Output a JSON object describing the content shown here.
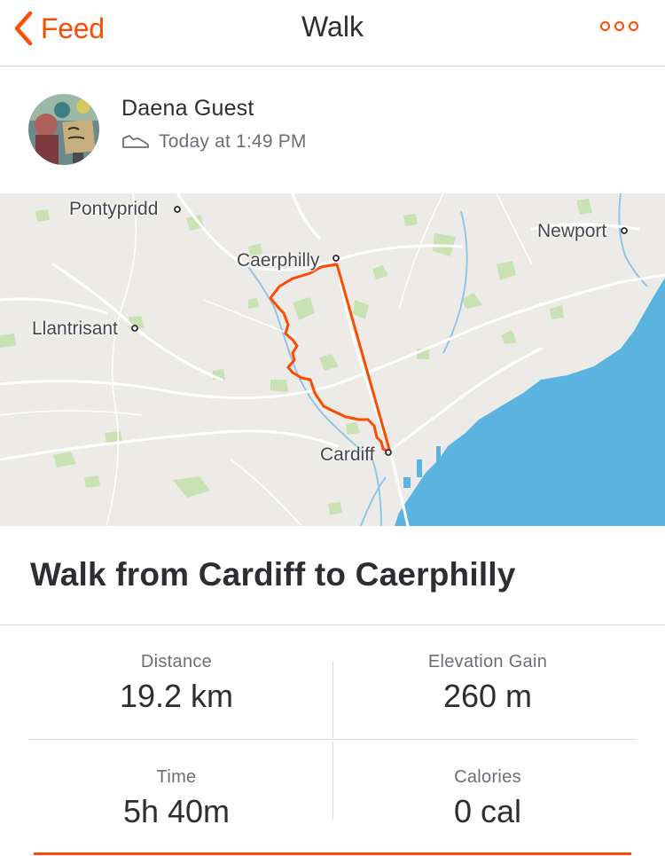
{
  "navbar": {
    "back_label": "Feed",
    "back_icon": "chevron-left-icon",
    "title": "Walk",
    "more_icon": "more-options-icon",
    "accent_color": "#fc4c02"
  },
  "athlete": {
    "name": "Daena Guest",
    "activity_icon": "shoe-icon",
    "timestamp": "Today at 1:49 PM"
  },
  "map": {
    "places": {
      "pontypridd": "Pontypridd",
      "newport": "Newport",
      "caerphilly": "Caerphilly",
      "llantrisant": "Llantrisant",
      "cardiff": "Cardiff"
    },
    "route_color": "#fc4c02",
    "sea_color": "#5bb3e0"
  },
  "activity": {
    "title": "Walk from Cardiff to Caerphilly"
  },
  "stats": [
    {
      "label": "Distance",
      "value": "19.2 km"
    },
    {
      "label": "Elevation Gain",
      "value": "260 m"
    },
    {
      "label": "Time",
      "value": "5h 40m"
    },
    {
      "label": "Calories",
      "value": "0 cal"
    }
  ]
}
